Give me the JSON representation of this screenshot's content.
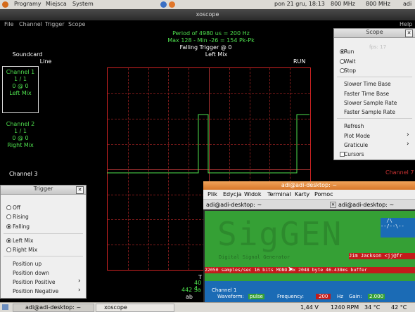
{
  "top_panel": {
    "menus": [
      "Programy",
      "Miejsca",
      "System"
    ],
    "clock": "pon 21 gru, 18:13",
    "cpu1": "800 MHz",
    "cpu2": "800 MHz",
    "user": "adi"
  },
  "window_title": "xoscope",
  "menubar": [
    "File",
    "Channel",
    "Trigger",
    "Scope"
  ],
  "help_label": "Help",
  "readout": {
    "period": "Period of   4980 us =   200 Hz",
    "minmax": "Max 128 - Min -26 = 154 Pk-Pk",
    "trigger": "Falling Trigger @ 0",
    "mix": "Left Mix",
    "run": "RUN",
    "fps": "fps: 17"
  },
  "soundcard": {
    "label": "Soundcard",
    "line": "Line"
  },
  "channel1": {
    "name": "Channel 1",
    "scale": "1 / 1",
    "pos": "0 @ 0",
    "src": "Left Mix"
  },
  "channel2": {
    "name": "Channel 2",
    "scale": "1 / 1",
    "pos": "0 @ 0",
    "src": "Right Mix"
  },
  "channel3": {
    "name": "Channel 3"
  },
  "channel7": {
    "name": "Channel 7"
  },
  "bottom_left_text": {
    "t": "T",
    "v": "40",
    "s": "4",
    "rate": "442 Sa",
    "ab": "ab"
  },
  "scope_menu": {
    "title": "Scope",
    "run": "Run",
    "wait": "Wait",
    "stop": "Stop",
    "slower_tb": "Slower Time Base",
    "faster_tb": "Faster Time Base",
    "slower_sr": "Slower Sample Rate",
    "faster_sr": "Faster Sample Rate",
    "refresh": "Refresh",
    "plot_mode": "Plot Mode",
    "graticule": "Graticule",
    "cursors": "Cursors"
  },
  "trigger_menu": {
    "title": "Trigger",
    "off": "Off",
    "rising": "Rising",
    "falling": "Falling",
    "left_mix": "Left Mix",
    "right_mix": "Right Mix",
    "pos_up": "Position up",
    "pos_down": "Position down",
    "pos_positive": "Position Positive",
    "pos_negative": "Position Negative"
  },
  "terminal": {
    "title": "adi@adi-desktop: ~",
    "menus": [
      "Plik",
      "Edycja",
      "Widok",
      "Terminal",
      "Karty",
      "Pomoc"
    ],
    "tab1": "adi@adi-desktop: ~",
    "tab2": "adi@adi-desktop: ~",
    "siggen_sub": "Digital    Signal Generator",
    "author": "Jim Jackson <jj@fr",
    "status": "22050 samples/sec 16 bits MONO    3x  2048 byte  46.438ms buffer",
    "ch_label": "Channel 1",
    "waveform_label": "Waveform:",
    "waveform_val": "pulse",
    "freq_label": "Frequency:",
    "freq_val": "200",
    "freq_unit": "Hz",
    "gain_label": "Gain:",
    "gain_val": "2.000"
  },
  "bottom_panel": {
    "task1": "adi@adi-desktop: ~",
    "task2": "xoscope",
    "volt": "1,44 V",
    "rpm": "1240 RPM",
    "t1": "34 °C",
    "t2": "42 °C"
  },
  "colors": {
    "trace": "#4ee04e",
    "grid": "#c22222",
    "channel7": "#cc3333"
  },
  "chart_data": {
    "type": "line",
    "series": [
      {
        "name": "Channel 1",
        "values": [
          0,
          0,
          0,
          0,
          128,
          0,
          0,
          0,
          0,
          128,
          0
        ]
      }
    ]
  }
}
